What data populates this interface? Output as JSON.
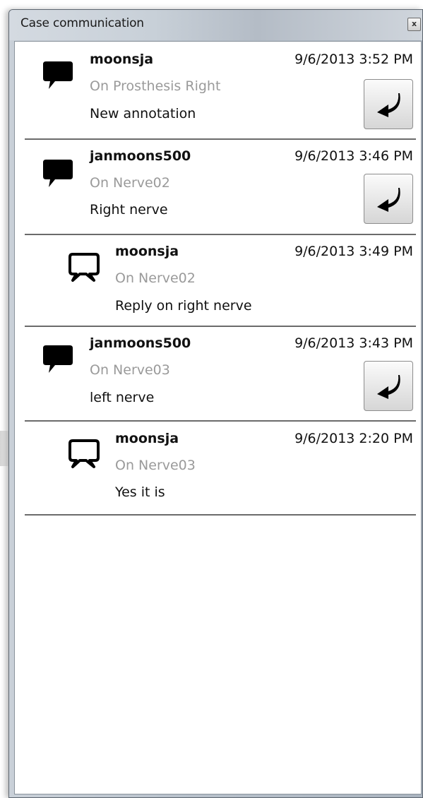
{
  "window": {
    "title": "Case communication",
    "close_label": "x"
  },
  "entries": [
    {
      "user": "moonsja",
      "time": "9/6/2013 3:52 PM",
      "target": "On Prosthesis Right",
      "message": "New annotation",
      "is_reply": false,
      "has_reply_button": true
    },
    {
      "user": "janmoons500",
      "time": "9/6/2013 3:46 PM",
      "target": "On Nerve02",
      "message": "Right nerve",
      "is_reply": false,
      "has_reply_button": true
    },
    {
      "user": "moonsja",
      "time": "9/6/2013 3:49 PM",
      "target": "On Nerve02",
      "message": "Reply on right nerve",
      "is_reply": true,
      "has_reply_button": false
    },
    {
      "user": "janmoons500",
      "time": "9/6/2013 3:43 PM",
      "target": "On Nerve03",
      "message": "left nerve",
      "is_reply": false,
      "has_reply_button": true
    },
    {
      "user": "moonsja",
      "time": "9/6/2013 2:20 PM",
      "target": "On Nerve03",
      "message": "Yes it is",
      "is_reply": true,
      "has_reply_button": false
    }
  ],
  "icons": {
    "comment": "speech-bubble-filled-icon",
    "reply_comment": "speech-bubble-outline-icon",
    "reply_action": "reply-arrow-icon"
  }
}
